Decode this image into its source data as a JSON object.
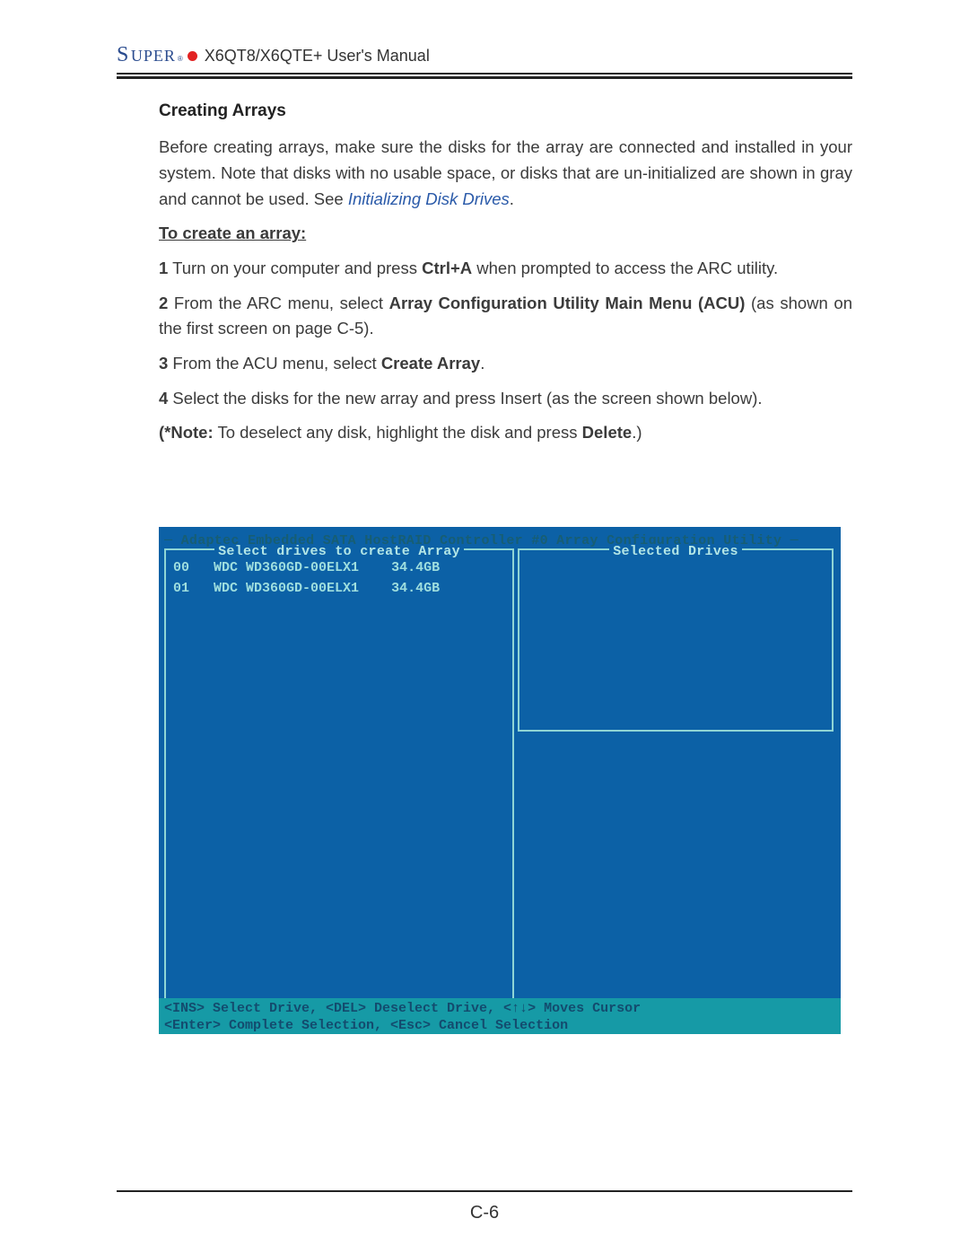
{
  "header": {
    "brand_first": "S",
    "brand_rest": "UPER",
    "brand_reg": "®",
    "doc_title": "X6QT8/X6QTE+ User's Manual"
  },
  "section": {
    "title": "Creating Arrays",
    "intro_a": "Before creating arrays, make sure the disks for the array are connected and installed in your system. Note that disks with no usable space, or disks that are un-initialized are shown in gray and cannot be used. See ",
    "intro_link": "Initializing Disk Drives",
    "intro_b": ".",
    "sub_heading": "To create an array:",
    "steps": [
      {
        "n": "1",
        "pre": " Turn on your computer and press ",
        "bold1": "Ctrl+A",
        "mid": " when prompted to access the ARC utility."
      },
      {
        "n": "2",
        "pre": " From the ARC menu, select ",
        "bold1": "Array Configuration Utility Main Menu (ACU)",
        "mid": " (as shown on the first screen on page C-5)."
      },
      {
        "n": "3",
        "pre": " From the ACU menu, select ",
        "bold1": "Create Array",
        "mid": "."
      },
      {
        "n": "4",
        "pre": " Select the disks for the new array and press Insert (as the screen shown below).",
        "bold1": "",
        "mid": ""
      }
    ],
    "note_lead": "(*Note:",
    "note_mid": " To deselect any disk, highlight the disk and press ",
    "note_bold": "Delete",
    "note_tail": ".)"
  },
  "figure": {
    "top_bar": "─ Adaptec Embedded SATA HostRAID Controller #0 Array Configuration Utility ─",
    "left_title": "Select drives to create Array",
    "right_title": "Selected Drives",
    "drives": [
      {
        "id": "00",
        "model": "WDC WD360GD-00ELX1",
        "size": "34.4GB"
      },
      {
        "id": "01",
        "model": "WDC WD360GD-00ELX1",
        "size": "34.4GB"
      }
    ],
    "help_line_1": "<INS> Select Drive, <DEL> Deselect Drive, <↑↓> Moves Cursor",
    "help_line_2": "<Enter> Complete Selection, <Esc> Cancel Selection"
  },
  "footer": {
    "page_number": "C-6"
  }
}
